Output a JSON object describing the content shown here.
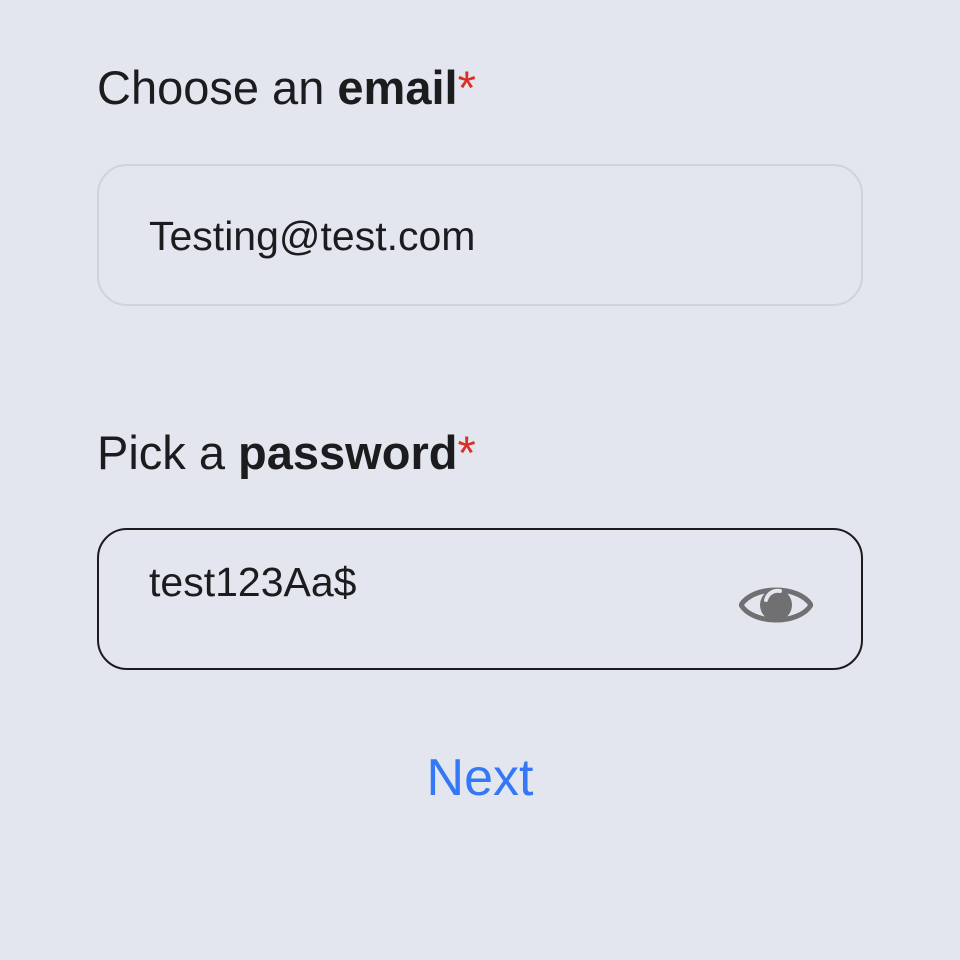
{
  "email_section": {
    "label_prefix": "Choose an ",
    "label_bold": "email",
    "required_mark": "*",
    "value": "Testing@test.com"
  },
  "password_section": {
    "label_prefix": "Pick a ",
    "label_bold": "password",
    "required_mark": "*",
    "value": "test123Aa$",
    "visibility_icon": "eye-icon"
  },
  "actions": {
    "next_label": "Next"
  },
  "colors": {
    "background": "#e3e6ef",
    "text": "#1c1c1e",
    "required": "#d93025",
    "accent": "#3478f6",
    "icon": "#707073"
  }
}
